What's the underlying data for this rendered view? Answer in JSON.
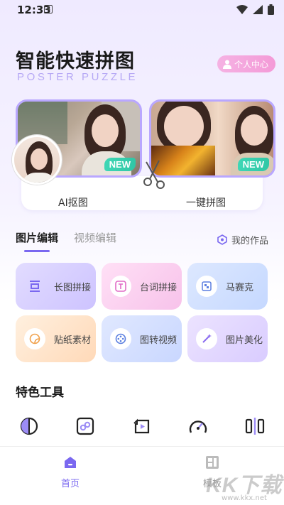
{
  "status_bar": {
    "time": "12:33",
    "app_badge": "A"
  },
  "header": {
    "title": "智能快速拼图",
    "subtitle": "POSTER PUZZLE",
    "personal_center_label": "个人中心"
  },
  "feature_cards": [
    {
      "label": "AI抠图",
      "badge": "NEW"
    },
    {
      "label": "一键拼图",
      "badge": "NEW"
    }
  ],
  "tabs": [
    {
      "label": "图片编辑",
      "active": true
    },
    {
      "label": "视频编辑",
      "active": false
    }
  ],
  "my_works_label": "我的作品",
  "tools": [
    {
      "label": "长图拼接",
      "icon": "long-image-icon",
      "color": "#d9d2ff"
    },
    {
      "label": "台词拼接",
      "icon": "text-t-icon",
      "color": "#fbd3f3"
    },
    {
      "label": "马赛克",
      "icon": "mosaic-icon",
      "color": "#cfe0ff"
    },
    {
      "label": "贴纸素材",
      "icon": "sticker-icon",
      "color": "#ffe3c7"
    },
    {
      "label": "图转视频",
      "icon": "film-reel-icon",
      "color": "#d4e0ff"
    },
    {
      "label": "图片美化",
      "icon": "magic-wand-icon",
      "color": "#e4d8ff"
    }
  ],
  "special_section_title": "特色工具",
  "special_tools": [
    "contrast-icon",
    "link-icon",
    "rotate-video-icon",
    "speed-gauge-icon",
    "split-icon"
  ],
  "bottom_nav": [
    {
      "label": "首页",
      "icon": "home-icon",
      "active": true
    },
    {
      "label": "模板",
      "icon": "template-icon",
      "active": false
    }
  ],
  "watermark": {
    "text": "KK下载",
    "url": "www.kkx.net"
  },
  "colors": {
    "accent": "#7a68f0",
    "new_badge": "#34cfae",
    "pink_button": "#f49ad7"
  }
}
